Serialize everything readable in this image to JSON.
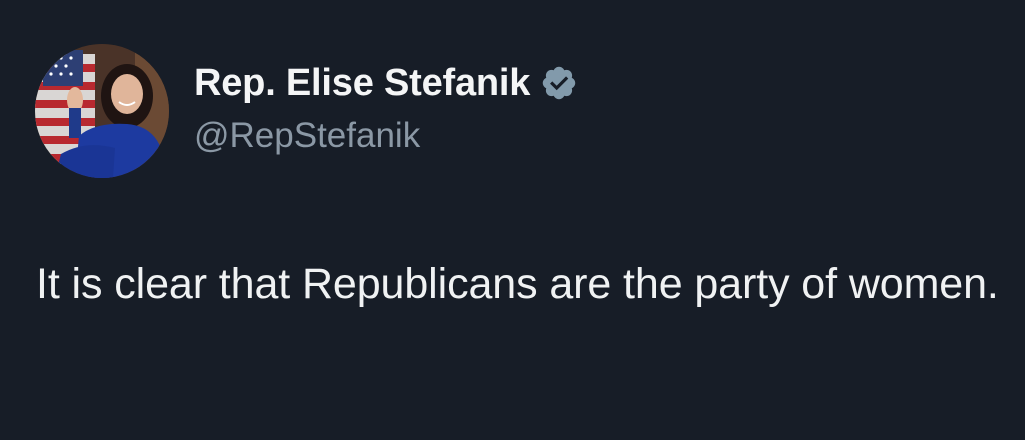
{
  "tweet": {
    "author": {
      "display_name": "Rep. Elise Stefanik",
      "handle": "@RepStefanik",
      "verified": true,
      "verified_badge_color": "#829aab"
    },
    "text": "It is clear that Republicans are the party of women."
  },
  "colors": {
    "background": "#171d27",
    "primary_text": "#e7e9ea",
    "secondary_text": "#8b98a5"
  },
  "icons": {
    "avatar": "profile-photo",
    "badge": "verified-badge-icon"
  }
}
